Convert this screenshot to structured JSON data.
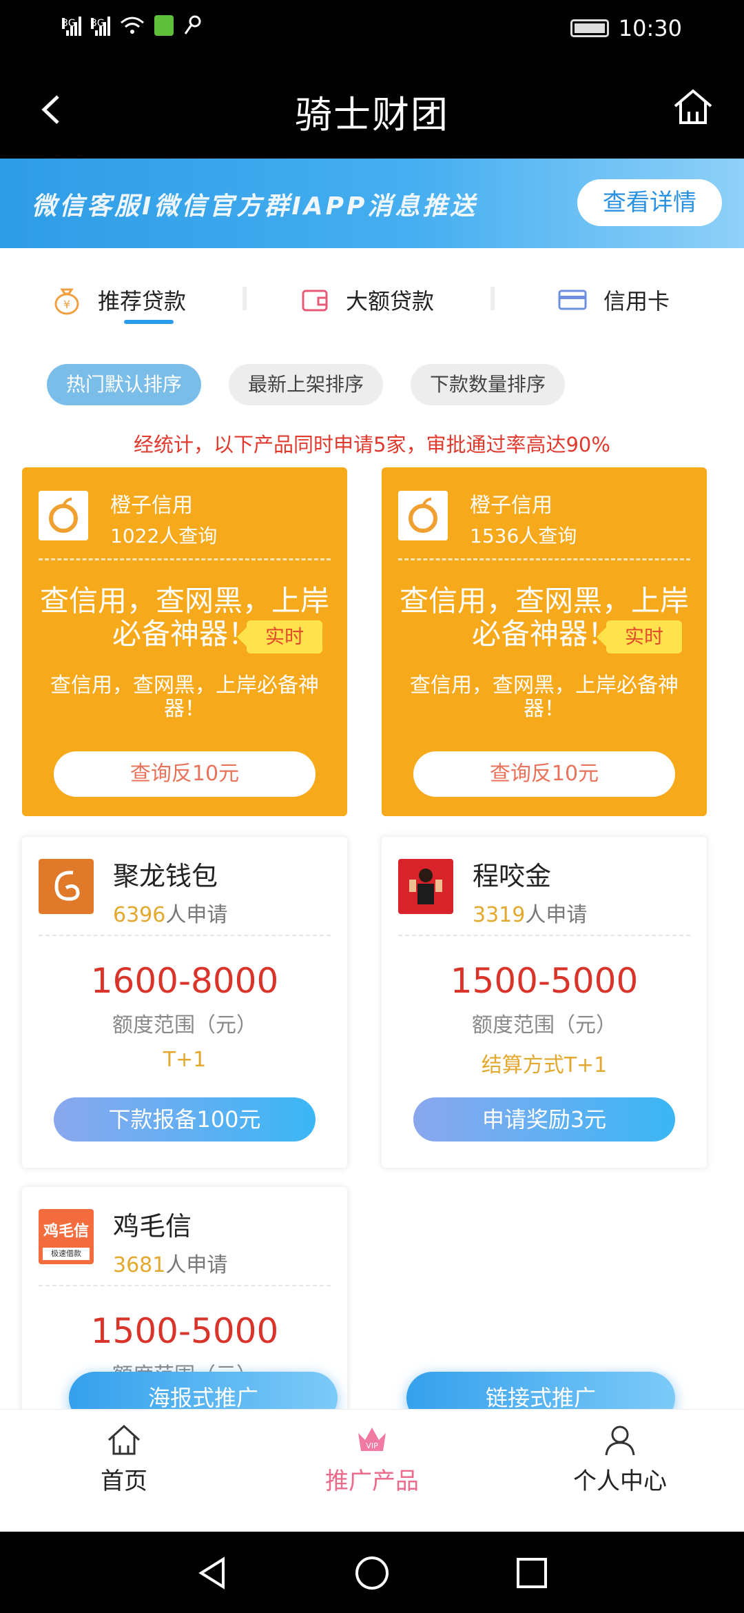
{
  "status_bar": {
    "signal1": "3G",
    "signal2": "3G",
    "time": "10:30"
  },
  "nav": {
    "title": "骑士财团"
  },
  "banner": {
    "text": "微信客服I微信官方群IAPP消息推送",
    "button": "查看详情"
  },
  "tabs": [
    {
      "label": "推荐贷款",
      "icon": "money-bag-icon",
      "active": true
    },
    {
      "label": "大额贷款",
      "icon": "wallet-icon",
      "active": false
    },
    {
      "label": "信用卡",
      "icon": "credit-card-icon",
      "active": false
    }
  ],
  "sort": [
    "热门默认排序",
    "最新上架排序",
    "下款数量排序"
  ],
  "notice": "经统计，以下产品同时申请5家，审批通过率高达90%",
  "promo_cards": [
    {
      "name": "橙子信用",
      "count": "1022人查询",
      "headline": "查信用，查网黑，上岸必备神器！",
      "tag": "实时",
      "desc": "查信用，查网黑，上岸必备神器！",
      "button": "查询反10元"
    },
    {
      "name": "橙子信用",
      "count": "1536人查询",
      "headline": "查信用，查网黑，上岸必备神器！",
      "tag": "实时",
      "desc": "查信用，查网黑，上岸必备神器！",
      "button": "查询反10元"
    }
  ],
  "loan_cards": [
    {
      "name": "聚龙钱包",
      "count_num": "6396",
      "count_suffix": "人申请",
      "range": "1600-8000",
      "range_label": "额度范围（元）",
      "method": "T+1",
      "button": "下款报备100元",
      "logo_color": "#e07a2a"
    },
    {
      "name": "程咬金",
      "count_num": "3319",
      "count_suffix": "人申请",
      "range": "1500-5000",
      "range_label": "额度范围（元）",
      "method": "结算方式T+1",
      "button": "申请奖励3元",
      "logo_color": "#d8232a"
    },
    {
      "name": "鸡毛信",
      "count_num": "3681",
      "count_suffix": "人申请",
      "range": "1500-5000",
      "range_label": "额度范围（元）",
      "logo_text": "鸡毛信",
      "logo_sub": "极速借款",
      "logo_color": "#f26c3e"
    }
  ],
  "float_buttons": [
    "海报式推广",
    "链接式推广"
  ],
  "tab_bar": [
    {
      "label": "首页",
      "icon": "home-icon"
    },
    {
      "label": "推广产品",
      "icon": "vip-crown-icon",
      "badge": "VIP"
    },
    {
      "label": "个人中心",
      "icon": "person-icon"
    }
  ]
}
